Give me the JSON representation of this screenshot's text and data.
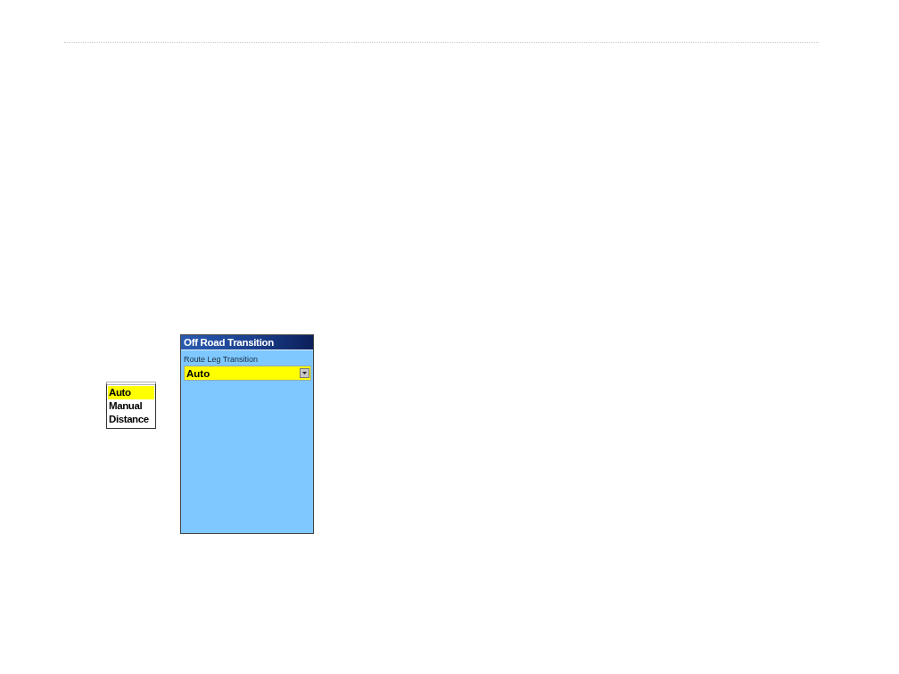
{
  "option_list": {
    "items": [
      {
        "label": "Auto",
        "selected": true
      },
      {
        "label": "Manual",
        "selected": false
      },
      {
        "label": "Distance",
        "selected": false
      }
    ]
  },
  "screen": {
    "title": "Off Road Transition",
    "field": {
      "label": "Route Leg Transition",
      "value": "Auto"
    }
  }
}
